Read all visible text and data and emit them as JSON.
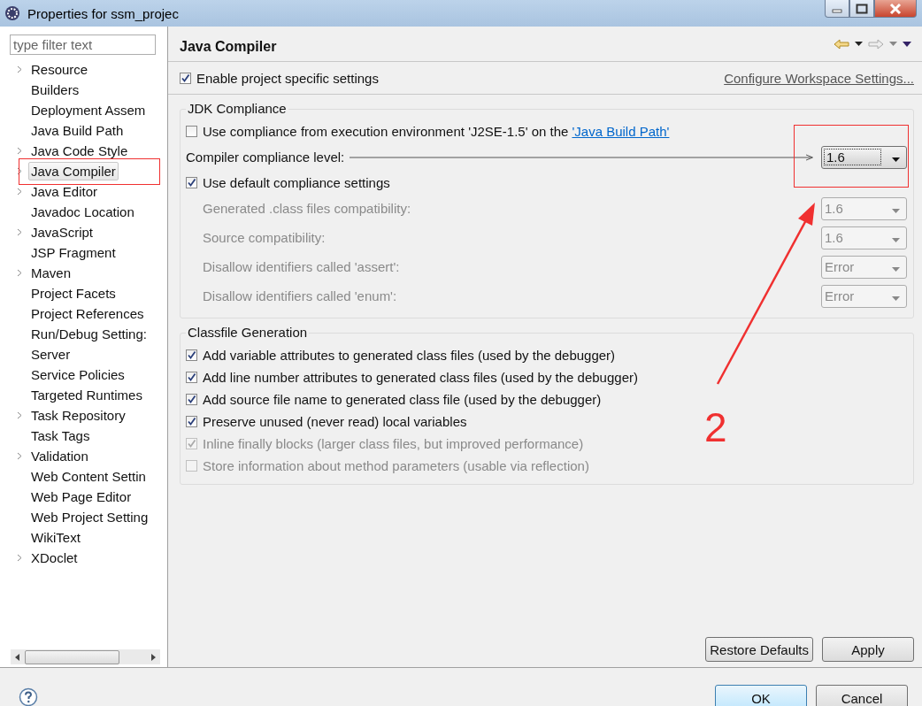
{
  "window": {
    "title": "Properties for ssm_projec"
  },
  "filter": {
    "placeholder": "type filter text"
  },
  "sidebar": {
    "items": [
      {
        "label": "Resource",
        "expandable": true,
        "selected": false
      },
      {
        "label": "Builders",
        "expandable": false,
        "selected": false
      },
      {
        "label": "Deployment Assem",
        "expandable": false,
        "selected": false
      },
      {
        "label": "Java Build Path",
        "expandable": false,
        "selected": false
      },
      {
        "label": "Java Code Style",
        "expandable": true,
        "selected": false
      },
      {
        "label": "Java Compiler",
        "expandable": true,
        "selected": true
      },
      {
        "label": "Java Editor",
        "expandable": true,
        "selected": false
      },
      {
        "label": "Javadoc Location",
        "expandable": false,
        "selected": false
      },
      {
        "label": "JavaScript",
        "expandable": true,
        "selected": false
      },
      {
        "label": "JSP Fragment",
        "expandable": false,
        "selected": false
      },
      {
        "label": "Maven",
        "expandable": true,
        "selected": false
      },
      {
        "label": "Project Facets",
        "expandable": false,
        "selected": false
      },
      {
        "label": "Project References",
        "expandable": false,
        "selected": false
      },
      {
        "label": "Run/Debug Setting:",
        "expandable": false,
        "selected": false
      },
      {
        "label": "Server",
        "expandable": false,
        "selected": false
      },
      {
        "label": "Service Policies",
        "expandable": false,
        "selected": false
      },
      {
        "label": "Targeted Runtimes",
        "expandable": false,
        "selected": false
      },
      {
        "label": "Task Repository",
        "expandable": true,
        "selected": false
      },
      {
        "label": "Task Tags",
        "expandable": false,
        "selected": false
      },
      {
        "label": "Validation",
        "expandable": true,
        "selected": false
      },
      {
        "label": "Web Content Settin",
        "expandable": false,
        "selected": false
      },
      {
        "label": "Web Page Editor",
        "expandable": false,
        "selected": false
      },
      {
        "label": "Web Project Setting",
        "expandable": false,
        "selected": false
      },
      {
        "label": "WikiText",
        "expandable": false,
        "selected": false
      },
      {
        "label": "XDoclet",
        "expandable": true,
        "selected": false
      }
    ]
  },
  "page": {
    "title": "Java Compiler",
    "enable": {
      "label": "Enable project specific settings",
      "checked": true
    },
    "workspace_link": "Configure Workspace Settings...",
    "groups": [
      {
        "title": "JDK Compliance",
        "rows": [
          {
            "kind": "checkbox",
            "label": "Use compliance from execution environment 'J2SE-1.5' on the ",
            "link": "'Java Build Path'",
            "checked": false,
            "disabled": false
          },
          {
            "kind": "combo",
            "label": "Compiler compliance level:",
            "value": "1.6",
            "disabled": false,
            "leader": true
          },
          {
            "kind": "checkbox",
            "label": "Use default compliance settings",
            "checked": true,
            "disabled": false
          },
          {
            "kind": "combo",
            "label": "Generated .class files compatibility:",
            "value": "1.6",
            "disabled": true,
            "leader": false
          },
          {
            "kind": "combo",
            "label": "Source compatibility:",
            "value": "1.6",
            "disabled": true,
            "leader": false
          },
          {
            "kind": "combo",
            "label": "Disallow identifiers called 'assert':",
            "value": "Error",
            "disabled": true,
            "leader": false
          },
          {
            "kind": "combo",
            "label": "Disallow identifiers called 'enum':",
            "value": "Error",
            "disabled": true,
            "leader": false
          }
        ]
      },
      {
        "title": "Classfile Generation",
        "rows": [
          {
            "kind": "checkbox",
            "label": "Add variable attributes to generated class files (used by the debugger)",
            "checked": true,
            "disabled": false
          },
          {
            "kind": "checkbox",
            "label": "Add line number attributes to generated class files (used by the debugger)",
            "checked": true,
            "disabled": false
          },
          {
            "kind": "checkbox",
            "label": "Add source file name to generated class file (used by the debugger)",
            "checked": true,
            "disabled": false
          },
          {
            "kind": "checkbox",
            "label": "Preserve unused (never read) local variables",
            "checked": true,
            "disabled": false
          },
          {
            "kind": "checkbox",
            "label": "Inline finally blocks (larger class files, but improved performance)",
            "checked": true,
            "disabled": true
          },
          {
            "kind": "checkbox",
            "label": "Store information about method parameters (usable via reflection)",
            "checked": false,
            "disabled": true
          }
        ]
      }
    ],
    "buttons": [
      "Restore Defaults",
      "Apply"
    ]
  },
  "footer": {
    "buttons": [
      {
        "label": "OK",
        "default": true
      },
      {
        "label": "Cancel",
        "default": false
      }
    ]
  },
  "annotations": [
    {
      "kind": "box"
    },
    {
      "kind": "box"
    },
    {
      "kind": "arrow"
    },
    {
      "kind": "label",
      "text": "2"
    }
  ]
}
